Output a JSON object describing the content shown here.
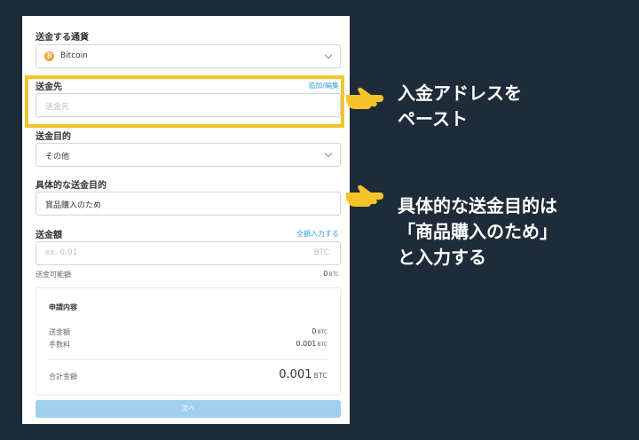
{
  "form": {
    "currency": {
      "label": "送金する通貨",
      "value": "Bitcoin",
      "icon": "bitcoin-icon"
    },
    "destination": {
      "label": "送金先",
      "link": "追加/編集",
      "placeholder": "送金先"
    },
    "purpose": {
      "label": "送金目的",
      "value": "その他"
    },
    "purpose_detail": {
      "label": "具体的な送金目的",
      "value": "賞品購入のため"
    },
    "amount": {
      "label": "送金額",
      "link": "全額入力する",
      "placeholder": "ex. 0.01",
      "unit": "BTC",
      "available_label": "送金可能額",
      "available_value": "0",
      "available_unit": "BTC"
    }
  },
  "summary": {
    "title": "申請内容",
    "rows": [
      {
        "label": "送金額",
        "value": "0",
        "unit": "BTC"
      },
      {
        "label": "手数料",
        "value": "0.001",
        "unit": "BTC"
      }
    ],
    "total_label": "合計金額",
    "total_value": "0.001",
    "total_unit": "BTC"
  },
  "next_button": "次へ",
  "annotations": {
    "first": [
      "入金アドレスを",
      "ペースト"
    ],
    "second": [
      "具体的な送金目的は",
      "「商品購入のため」",
      "と入力する"
    ]
  },
  "colors": {
    "background": "#1e2b38",
    "highlight": "#f5c42a",
    "link": "#3a9fd8",
    "button": "#9fd0ee",
    "bitcoin": "#f2a23a"
  }
}
